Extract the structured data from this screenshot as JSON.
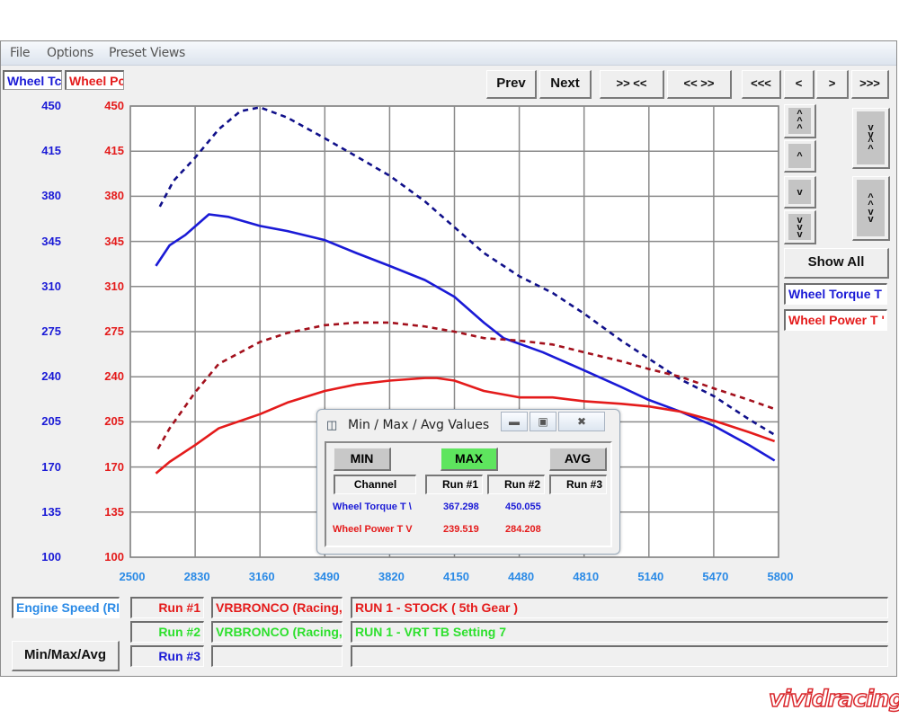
{
  "menu": [
    "File",
    "Options",
    "Preset Views"
  ],
  "tabs": [
    {
      "label": "Wheel Tc",
      "color": "#1a1ad6"
    },
    {
      "label": "Wheel Pc",
      "color": "#e41b1b"
    }
  ],
  "toolbar": {
    "prev": "Prev",
    "next": "Next",
    "zoom_in": ">> <<",
    "zoom_out": "<< >>",
    "first": "<<<",
    "left": "<",
    "right": ">",
    "last": ">>>"
  },
  "side": {
    "up_fast": "up-triple",
    "up": "up-single",
    "down": "down-single",
    "down_fast": "down-triple",
    "expand": "expand",
    "compress": "compress",
    "show_all": "Show All",
    "legend": [
      {
        "label": "Wheel Torque T",
        "color": "#1a1ad6"
      },
      {
        "label": "Wheel Power T '",
        "color": "#e41b1b"
      }
    ]
  },
  "footer": {
    "x_channel": "Engine Speed (RI",
    "minmax_button": "Min/Max/Avg",
    "runs": [
      {
        "label": "Run #1",
        "vehicle": "VRBRONCO (Racing, \\",
        "description": "RUN 1 - STOCK ( 5th Gear )",
        "color": "#e41b1b"
      },
      {
        "label": "Run #2",
        "vehicle": "VRBRONCO (Racing, \\",
        "description": "RUN 1 - VRT TB Setting 7",
        "color": "#2ee02e"
      },
      {
        "label": "Run #3",
        "vehicle": "",
        "description": "",
        "color": "#1a1ad6"
      }
    ]
  },
  "dialog": {
    "title": "Min / Max / Avg Values",
    "min": "MIN",
    "max": "MAX",
    "avg": "AVG",
    "active": "MAX",
    "headers": [
      "Channel",
      "Run #1",
      "Run #2",
      "Run #3"
    ],
    "rows": [
      {
        "channel": "Wheel Torque T \\",
        "run1": "367.298",
        "run2": "450.055",
        "run3": "",
        "color": "#1a1ad6"
      },
      {
        "channel": "Wheel Power T V",
        "run1": "239.519",
        "run2": "284.208",
        "run3": "",
        "color": "#e41b1b"
      }
    ]
  },
  "logo": "vividracing",
  "chart_data": {
    "type": "line",
    "title": "",
    "xlabel": "Engine Speed (RPM)",
    "ylabel_left": "Wheel Torque",
    "ylabel_right": "Wheel Power",
    "xlim": [
      2500,
      5800
    ],
    "ylim": [
      100,
      450
    ],
    "x_ticks": [
      2500,
      2830,
      3160,
      3490,
      3820,
      4150,
      4480,
      4810,
      5140,
      5470,
      5800
    ],
    "y_ticks": [
      450,
      415,
      380,
      345,
      310,
      275,
      240,
      205,
      170,
      135,
      100
    ],
    "grid": true,
    "series": [
      {
        "name": "Wheel Torque - Run #1",
        "color": "#1a1ad6",
        "style": "solid",
        "x": [
          2630,
          2700,
          2780,
          2900,
          3000,
          3160,
          3300,
          3490,
          3650,
          3820,
          4000,
          4150,
          4300,
          4400,
          4600,
          4810,
          5000,
          5140,
          5300,
          5470,
          5650,
          5780
        ],
        "y": [
          326,
          342,
          350,
          366,
          364,
          357,
          353,
          346,
          336,
          326,
          315,
          302,
          282,
          270,
          259,
          245,
          232,
          222,
          213,
          202,
          187,
          175
        ]
      },
      {
        "name": "Wheel Torque - Run #2",
        "color": "#10108a",
        "style": "dashed",
        "x": [
          2650,
          2720,
          2830,
          2950,
          3060,
          3160,
          3300,
          3490,
          3650,
          3820,
          4000,
          4150,
          4300,
          4480,
          4650,
          4810,
          5000,
          5140,
          5300,
          5470,
          5650,
          5780
        ],
        "y": [
          372,
          392,
          410,
          432,
          446,
          449,
          441,
          425,
          411,
          396,
          376,
          356,
          336,
          318,
          305,
          289,
          268,
          254,
          238,
          225,
          207,
          195
        ]
      },
      {
        "name": "Wheel Power - Run #1",
        "color": "#e41b1b",
        "style": "solid",
        "x": [
          2630,
          2700,
          2830,
          2950,
          3160,
          3300,
          3490,
          3650,
          3820,
          4000,
          4060,
          4150,
          4300,
          4480,
          4650,
          4810,
          5000,
          5140,
          5300,
          5470,
          5650,
          5780
        ],
        "y": [
          165,
          174,
          187,
          200,
          211,
          220,
          229,
          234,
          237,
          239,
          239,
          237,
          229,
          224,
          224,
          221,
          219,
          217,
          213,
          206,
          197,
          190
        ]
      },
      {
        "name": "Wheel Power - Run #2",
        "color": "#a3101c",
        "style": "dashed",
        "x": [
          2640,
          2700,
          2830,
          2950,
          3160,
          3300,
          3490,
          3650,
          3820,
          4000,
          4150,
          4300,
          4480,
          4650,
          4810,
          5000,
          5140,
          5300,
          5470,
          5650,
          5780
        ],
        "y": [
          184,
          200,
          228,
          250,
          267,
          274,
          280,
          282,
          282,
          279,
          275,
          270,
          268,
          265,
          259,
          252,
          246,
          240,
          231,
          222,
          215
        ]
      }
    ]
  }
}
